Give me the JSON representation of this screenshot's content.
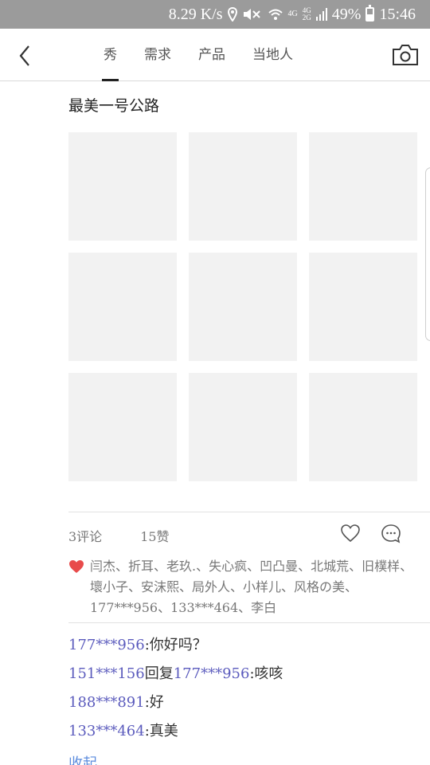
{
  "status_bar": {
    "speed": "8.29 K/s",
    "network_a": "4G",
    "network_b_top": "4G",
    "network_b_bottom": "2G",
    "battery": "49%",
    "time": "15:46"
  },
  "header": {
    "tabs": [
      {
        "label": "秀",
        "active": true
      },
      {
        "label": "需求",
        "active": false
      },
      {
        "label": "产品",
        "active": false
      },
      {
        "label": "当地人",
        "active": false
      }
    ]
  },
  "post": {
    "title": "最美一号公路",
    "photos": [
      "",
      "",
      "",
      "",
      "",
      "",
      "",
      "",
      ""
    ],
    "comments_count": "3评论",
    "likes_count": "15赞",
    "liked_by": "闫杰、折耳、老玖.、失心疯、凹凸曼、北城荒、旧樸样、壞小子、安沫熙、局外人、小样儿、风格の美、177***956、133***464、李白",
    "comments": [
      {
        "user": "177***956",
        "text": ":你好吗？"
      },
      {
        "user": "151***156",
        "text": "回复"
      },
      {
        "user": "188***891",
        "text": ":好"
      },
      {
        "user": "133***464",
        "text": ":真美"
      }
    ],
    "reply_target": "177***956",
    "reply_text": ":咳咳",
    "collapse_label": "收起"
  },
  "colors": {
    "status_bar_bg": "#9b9b9b",
    "photo_placeholder": "#f2f2f2",
    "username": "#5b5bbd",
    "collapse_link": "#5b8bdd",
    "like_heart": "#e84b4b"
  }
}
